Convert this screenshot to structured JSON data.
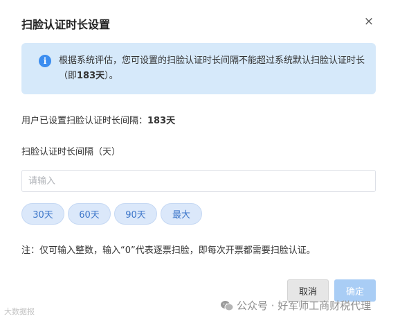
{
  "dialog": {
    "title": "扫脸认证时长设置",
    "close_icon": "×"
  },
  "info": {
    "icon": "i",
    "text_before": "根据系统评估，您可设置的扫脸认证时长间隔不能超过系统默认扫脸认证时长（即",
    "text_bold": "183天",
    "text_after": "）。"
  },
  "current_setting": {
    "label": "用户已设置扫脸认证时长间隔：",
    "value": "183天"
  },
  "field": {
    "label": "扫脸认证时长间隔（天）",
    "placeholder": "请输入",
    "value": ""
  },
  "presets": [
    "30天",
    "60天",
    "90天",
    "最大"
  ],
  "note": "注：仅可输入整数，输入“0”代表逐票扫脸，即每次开票都需要扫脸认证。",
  "buttons": {
    "cancel": "取消",
    "confirm": "确定"
  },
  "watermark": {
    "left": "大数据报",
    "right": "公众号 · 好军师工商财税代理"
  }
}
